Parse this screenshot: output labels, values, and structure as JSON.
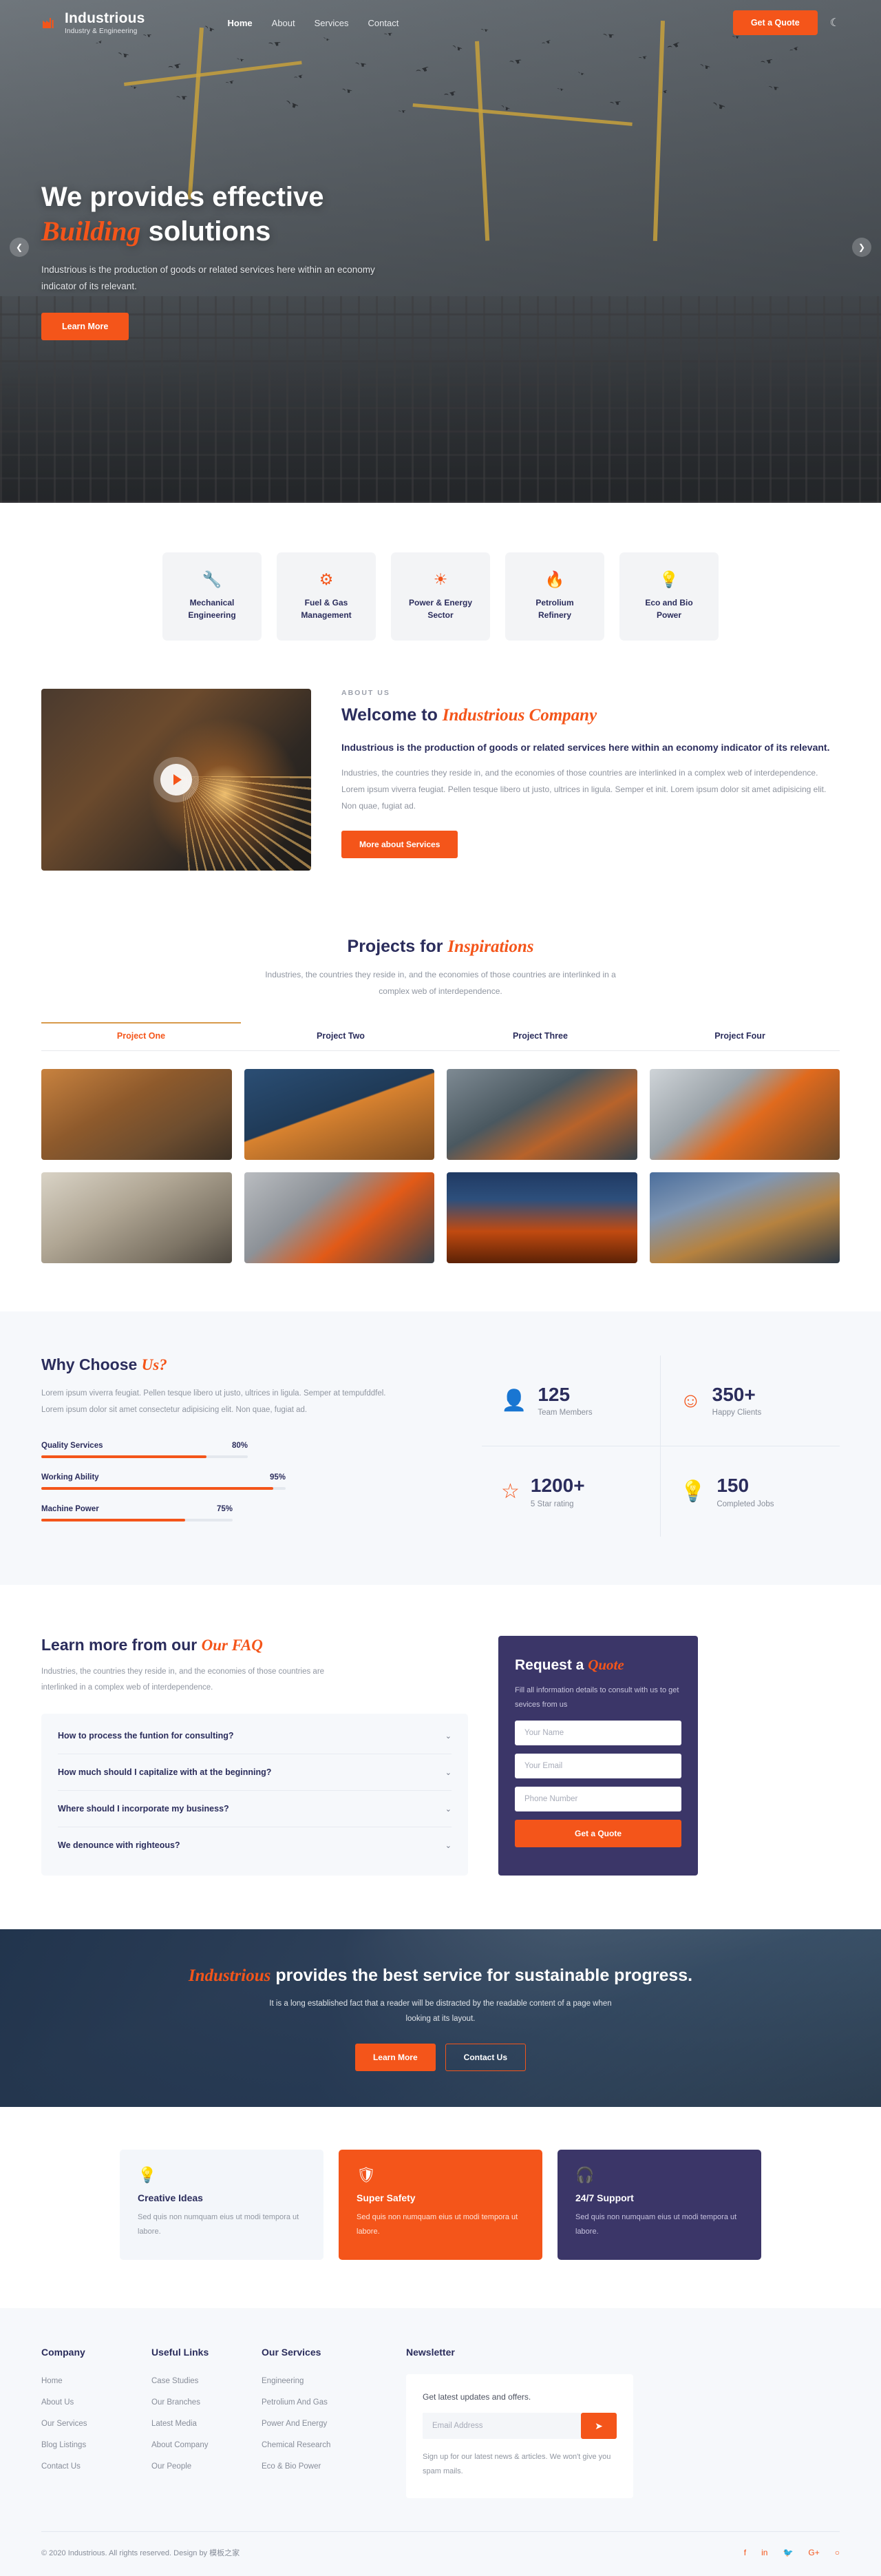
{
  "header": {
    "brand_name": "Industrious",
    "brand_tagline": "Industry & Engineering",
    "nav": [
      {
        "label": "Home",
        "active": true
      },
      {
        "label": "About",
        "active": false
      },
      {
        "label": "Services",
        "active": false
      },
      {
        "label": "Contact",
        "active": false
      }
    ],
    "cta_label": "Get a Quote",
    "theme_icon": "moon-icon"
  },
  "hero": {
    "title_line1": "We provides effective",
    "title_italic": "Building",
    "title_rest": "solutions",
    "paragraph": "Industrious is the production of goods or related services here within an economy indicator of its relevant.",
    "button_label": "Learn More",
    "prev_icon": "chevron-left-icon",
    "next_icon": "chevron-right-icon"
  },
  "services": [
    {
      "icon": "wrench-icon",
      "glyph": "🔧",
      "line1": "Mechanical",
      "line2": "Engineering"
    },
    {
      "icon": "gears-icon",
      "glyph": "⚙",
      "line1": "Fuel & Gas",
      "line2": "Management"
    },
    {
      "icon": "sun-gear-icon",
      "glyph": "☀",
      "line1": "Power & Energy",
      "line2": "Sector"
    },
    {
      "icon": "flame-icon",
      "glyph": "🔥",
      "line1": "Petrolium",
      "line2": "Refinery"
    },
    {
      "icon": "bulb-icon",
      "glyph": "💡",
      "line1": "Eco and Bio",
      "line2": "Power"
    }
  ],
  "about": {
    "kicker": "ABOUT US",
    "heading_plain": "Welcome to ",
    "heading_italic": "Industrious Company",
    "lead": "Industrious is the production of goods or related services here within an economy indicator of its relevant.",
    "body": "Industries, the countries they reside in, and the economies of those countries are interlinked in a complex web of interdependence. Lorem ipsum viverra feugiat. Pellen tesque libero ut justo, ultrices in ligula. Semper et init. Lorem ipsum dolor sit amet adipisicing elit. Non quae, fugiat ad.",
    "button_label": "More about Services",
    "play_icon": "play-icon"
  },
  "projects": {
    "heading_plain": "Projects for ",
    "heading_italic": "Inspirations",
    "subtitle": "Industries, the countries they reside in, and the economies of those countries are interlinked in a complex web of interdependence.",
    "tabs": [
      {
        "label": "Project One",
        "active": true
      },
      {
        "label": "Project Two",
        "active": false
      },
      {
        "label": "Project Three",
        "active": false
      },
      {
        "label": "Project Four",
        "active": false
      }
    ],
    "thumbs": [
      "warehouse-timber-yard",
      "worker-hardhat-blue",
      "factory-pipes-refinery",
      "excavator-orange",
      "construction-site-columns",
      "industrial-plant-interior",
      "refinery-flare-sunset",
      "refinery-towers-day"
    ]
  },
  "why": {
    "heading_plain": "Why Choose ",
    "heading_italic": "Us?",
    "paragraph": "Lorem ipsum viverra feugiat. Pellen tesque libero ut justo, ultrices in ligula. Semper at tempufddfel. Lorem ipsum dolor sit amet consectetur adipisicing elit. Non quae, fugiat ad.",
    "bars": [
      {
        "label": "Quality Services",
        "pct": "80%",
        "value": 80
      },
      {
        "label": "Working Ability",
        "pct": "95%",
        "value": 95
      },
      {
        "label": "Machine Power",
        "pct": "75%",
        "value": 75
      }
    ],
    "stats": [
      {
        "icon": "user-icon",
        "glyph": "👤",
        "number": "125",
        "label": "Team Members"
      },
      {
        "icon": "smiley-icon",
        "glyph": "☺",
        "number": "350+",
        "label": "Happy Clients"
      },
      {
        "icon": "star-icon",
        "glyph": "☆",
        "number": "1200+",
        "label": "5 Star rating"
      },
      {
        "icon": "bulb-icon",
        "glyph": "💡",
        "number": "150",
        "label": "Completed Jobs"
      }
    ]
  },
  "faq": {
    "heading_plain": "Learn more from our ",
    "heading_italic": "Our FAQ",
    "paragraph": "Industries, the countries they reside in, and the economies of those countries are interlinked in a complex web of interdependence.",
    "items": [
      "How to process the funtion for consulting?",
      "How much should I capitalize with at the beginning?",
      "Where should I incorporate my business?",
      "We denounce with righteous?"
    ],
    "chevron_icon": "chevron-down-icon"
  },
  "quote": {
    "heading_plain": "Request a ",
    "heading_italic": "Quote",
    "paragraph": "Fill all information details to consult with us to get sevices from us",
    "name_placeholder": "Your Name",
    "email_placeholder": "Your Email",
    "phone_placeholder": "Phone Number",
    "button_label": "Get a Quote"
  },
  "cta": {
    "heading_italic": "Industrious",
    "heading_rest": " provides the best service for sustainable progress.",
    "paragraph": "It is a long established fact that a reader will be distracted by the readable content of a page when looking at its layout.",
    "primary_label": "Learn More",
    "secondary_label": "Contact Us"
  },
  "features": [
    {
      "icon": "bulb-icon",
      "glyph": "💡",
      "title": "Creative Ideas",
      "desc": "Sed quis non numquam eius ut modi tempora ut labore."
    },
    {
      "icon": "shield-icon",
      "glyph": "🛡",
      "title": "Super Safety",
      "desc": "Sed quis non numquam eius ut modi tempora ut labore."
    },
    {
      "icon": "headset-icon",
      "glyph": "🎧",
      "title": "24/7 Support",
      "desc": "Sed quis non numquam eius ut modi tempora ut labore."
    }
  ],
  "footer": {
    "columns": [
      {
        "title": "Company",
        "links": [
          "Home",
          "About Us",
          "Our Services",
          "Blog Listings",
          "Contact Us"
        ]
      },
      {
        "title": "Useful Links",
        "links": [
          "Case Studies",
          "Our Branches",
          "Latest Media",
          "About Company",
          "Our People"
        ]
      },
      {
        "title": "Our Services",
        "links": [
          "Engineering",
          "Petrolium And Gas",
          "Power And Energy",
          "Chemical Research",
          "Eco & Bio Power"
        ]
      }
    ],
    "newsletter": {
      "title": "Newsletter",
      "text": "Get latest updates and offers.",
      "placeholder": "Email Address",
      "send_icon": "send-icon",
      "note": "Sign up for our latest news & articles. We won't give you spam mails."
    },
    "copyright": "© 2020 Industrious. All rights reserved. Design by 模板之家",
    "social": [
      {
        "name": "facebook-icon",
        "glyph": "f"
      },
      {
        "name": "linkedin-icon",
        "glyph": "in"
      },
      {
        "name": "twitter-icon",
        "glyph": "🐦"
      },
      {
        "name": "google-plus-icon",
        "glyph": "G+"
      },
      {
        "name": "github-icon",
        "glyph": "○"
      }
    ]
  },
  "colors": {
    "accent": "#f4551a",
    "navy": "#2b2d5c",
    "purple": "#3b3668",
    "light": "#f6f8fb"
  }
}
